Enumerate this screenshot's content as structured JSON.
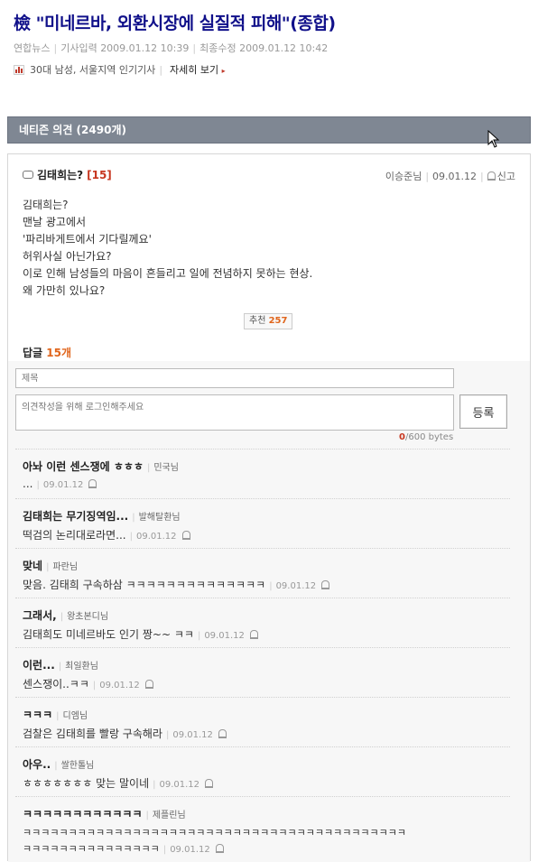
{
  "article": {
    "title": "檢 \"미네르바, 외환시장에 실질적 피해\"(종합)",
    "source": "연합뉴스",
    "input_label": "기사입력",
    "input_date": "2009.01.12 10:39",
    "edit_label": "최종수정",
    "edit_date": "2009.01.12 10:42",
    "popular_text": "30대 남성, 서울지역 인기기사",
    "more_label": "자세히 보기"
  },
  "comments_header": {
    "label": "네티즌 의견 (2490개)"
  },
  "post": {
    "title": "김태희는?",
    "reply_count": "[15]",
    "author": "이승준님",
    "date": "09.01.12",
    "report_label": "신고",
    "body": "김태희는?\n맨날 광고에서\n'파리바게트에서 기다릴께요'\n허위사실 아닌가요?\n이로 인해 남성들의 마음이 흔들리고 일에 전념하지 못하는 현상.\n왜 가만히 있나요?",
    "recommend_label": "추천",
    "recommend_count": "257"
  },
  "reply_section": {
    "label": "답글",
    "count": "15개",
    "title_placeholder": "제목",
    "body_placeholder": "의견작성을 위해 로그인해주세요",
    "submit_label": "등록",
    "bytes_current": "0",
    "bytes_max": "/600 bytes"
  },
  "replies": [
    {
      "title": "아놔 이런 센스쟁에 ㅎㅎㅎ",
      "author": "민국님",
      "text": "...",
      "date": "09.01.12"
    },
    {
      "title": "김태희는 무기징역임...",
      "author": "발해탈환님",
      "text": "떡검의 논리대로라면...",
      "date": "09.01.12"
    },
    {
      "title": "맞네",
      "author": "파란님",
      "text": "맞음. 김태희 구속하삼 ㅋㅋㅋㅋㅋㅋㅋㅋㅋㅋㅋㅋㅋㅋ",
      "date": "09.01.12"
    },
    {
      "title": "그래서,",
      "author": "왕초본디님",
      "text": "김태희도 미네르바도 인기 짱~~ ㅋㅋ",
      "date": "09.01.12"
    },
    {
      "title": "이런...",
      "author": "최일환님",
      "text": "센스쟁이..ㅋㅋ",
      "date": "09.01.12"
    },
    {
      "title": "ㅋㅋㅋ",
      "author": "디엠님",
      "text": "검찰은 김태희를 빨랑 구속해라",
      "date": "09.01.12"
    },
    {
      "title": "아우..",
      "author": "쌀한톨님",
      "text": "ㅎㅎㅎㅎㅎㅎㅎ 맞는 말이네",
      "date": "09.01.12"
    },
    {
      "title": "ㅋㅋㅋㅋㅋㅋㅋㅋㅋㅋㅋㅋ",
      "author": "제플린님",
      "text": "ㅋㅋㅋㅋㅋㅋㅋㅋㅋㅋㅋㅋㅋㅋㅋㅋㅋㅋㅋㅋㅋㅋㅋㅋㅋㅋㅋㅋㅋㅋㅋㅋㅋㅋㅋㅋㅋㅋㅋㅋㅋㅋ",
      "text2": "ㅋㅋㅋㅋㅋㅋㅋㅋㅋㅋㅋㅋㅋㅋㅋ",
      "date": "09.01.12"
    }
  ]
}
